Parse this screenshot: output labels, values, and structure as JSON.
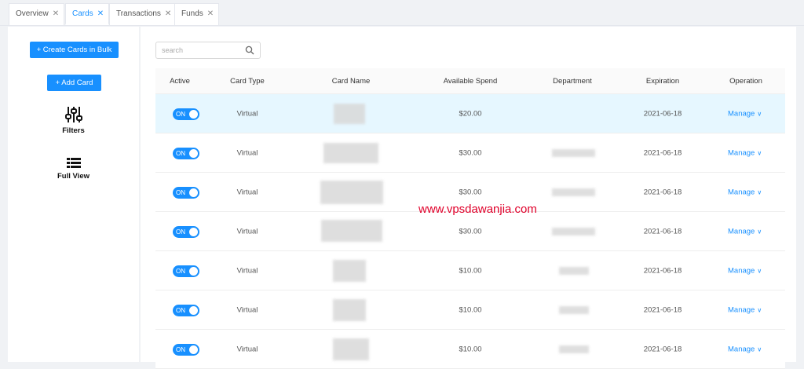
{
  "tabs": [
    {
      "label": "Overview",
      "active": false
    },
    {
      "label": "Cards",
      "active": true
    },
    {
      "label": "Transactions",
      "active": false
    },
    {
      "label": "Funds",
      "active": false
    }
  ],
  "sidebar": {
    "bulk_button": "+ Create Cards in Bulk",
    "add_button": "+ Add Card",
    "filters_label": "Filters",
    "full_view_label": "Full View"
  },
  "search": {
    "placeholder": "search"
  },
  "table": {
    "headers": [
      "Active",
      "Card Type",
      "Card Name",
      "Available Spend",
      "Department",
      "Expiration",
      "Operation"
    ],
    "rows": [
      {
        "active": "ON",
        "type": "Virtual",
        "spend": "$20.00",
        "expiration": "2021-06-18",
        "operation": "Manage"
      },
      {
        "active": "ON",
        "type": "Virtual",
        "spend": "$30.00",
        "expiration": "2021-06-18",
        "operation": "Manage"
      },
      {
        "active": "ON",
        "type": "Virtual",
        "spend": "$30.00",
        "expiration": "2021-06-18",
        "operation": "Manage"
      },
      {
        "active": "ON",
        "type": "Virtual",
        "spend": "$30.00",
        "expiration": "2021-06-18",
        "operation": "Manage"
      },
      {
        "active": "ON",
        "type": "Virtual",
        "spend": "$10.00",
        "expiration": "2021-06-18",
        "operation": "Manage"
      },
      {
        "active": "ON",
        "type": "Virtual",
        "spend": "$10.00",
        "expiration": "2021-06-18",
        "operation": "Manage"
      },
      {
        "active": "ON",
        "type": "Virtual",
        "spend": "$10.00",
        "expiration": "2021-06-18",
        "operation": "Manage"
      }
    ]
  },
  "watermark": "www.vpsdawanjia.com",
  "colors": {
    "accent": "#1890ff",
    "highlight_row": "#e6f7ff",
    "watermark": "#e0002a"
  }
}
